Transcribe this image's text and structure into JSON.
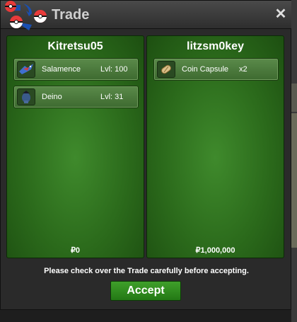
{
  "window": {
    "title": "Trade"
  },
  "left_player": {
    "name": "Kitretsu05",
    "items": [
      {
        "name": "Salamence",
        "level": "Lvl: 100",
        "icon": "salamence-icon"
      },
      {
        "name": "Deino",
        "level": "Lvl: 31",
        "icon": "deino-icon"
      }
    ],
    "money": "₽0"
  },
  "right_player": {
    "name": "litzsm0key",
    "items": [
      {
        "name": "Coin Capsule",
        "quantity": "x2",
        "icon": "coin-capsule-icon"
      }
    ],
    "money": "₽1,000,000"
  },
  "footer": {
    "notice": "Please check over the Trade carefully before accepting.",
    "accept_label": "Accept"
  },
  "colors": {
    "panel_green": "#2b6a1b",
    "accept_green": "#2f8c20"
  }
}
